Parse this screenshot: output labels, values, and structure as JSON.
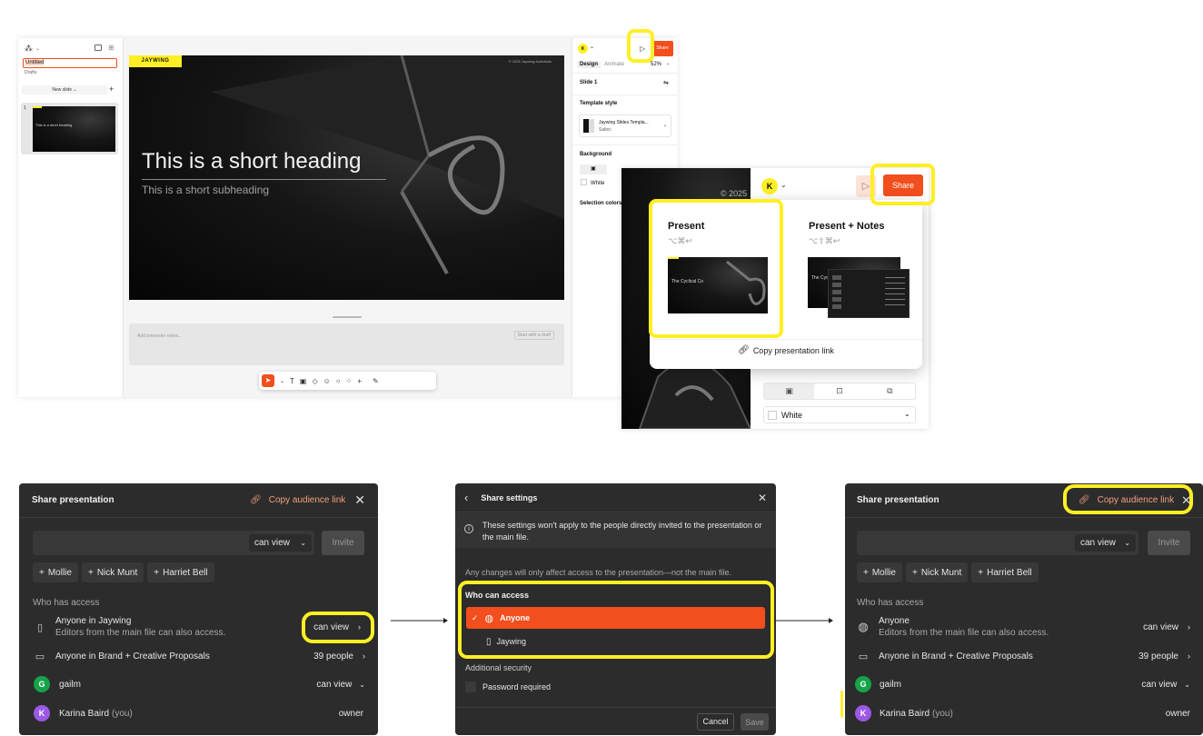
{
  "editor": {
    "file_title": "Untitled",
    "file_location": "Drafts",
    "new_slide": "New slide ⌄",
    "slide_number": "1",
    "thumb_heading": "This is a short heading",
    "brand_tag": "JAYWING",
    "copyright": "© 2025 Jaywing Audiobots",
    "heading": "This is a short heading",
    "subheading": "This is a short subheading",
    "notes_placeholder": "Add presenter notes...",
    "draft_button": "Start with a draft",
    "right": {
      "avatar": "K",
      "share": "Share",
      "tab_design": "Design",
      "tab_animate": "Animate",
      "zoom": "52%",
      "slide_label": "Slide 1",
      "template_style": "Template style",
      "template_name": "Jaywing Slides Templa...",
      "template_sub": "Saltec",
      "background": "Background",
      "bg_value": "White",
      "selection_colors": "Selection colors"
    }
  },
  "present": {
    "avatar": "K",
    "share": "Share",
    "copyright_partial": "© 2025 J",
    "option1_title": "Present",
    "option1_keys": "⌥⌘↩",
    "option1_thumb": "The Cyclical Co",
    "option2_title": "Present + Notes",
    "option2_keys": "⌥⇧⌘↩",
    "option2_thumb": "The Cyc",
    "copy_link": "Copy presentation link",
    "bg_value": "White"
  },
  "share1": {
    "title": "Share presentation",
    "copy_link": "Copy audience link",
    "permission": "can view",
    "invite": "Invite",
    "suggestions": [
      "Mollie",
      "Nick Munt",
      "Harriet Bell"
    ],
    "who_has_access": "Who has access",
    "rows": [
      {
        "name": "Anyone in Jaywing",
        "sub": "Editors from the main file can also access.",
        "right": "can view"
      },
      {
        "name": "Anyone in Brand + Creative Proposals",
        "right": "39 people"
      },
      {
        "name": "gailm",
        "right": "can view",
        "avatar": "G"
      },
      {
        "name": "Karina Baird",
        "you": "(you)",
        "right": "owner",
        "avatar": "K"
      }
    ]
  },
  "settings": {
    "title": "Share settings",
    "notice": "These settings won't apply to the people directly invited to the presentation or the main file.",
    "info": "Any changes will only affect access to the presentation—not the main file.",
    "who_can_access": "Who can access",
    "option_selected": "Anyone",
    "option_other": "Jaywing",
    "additional_security": "Additional security",
    "password": "Password required",
    "cancel": "Cancel",
    "save": "Save"
  },
  "share2": {
    "title": "Share presentation",
    "copy_link": "Copy audience link",
    "permission": "can view",
    "invite": "Invite",
    "suggestions": [
      "Mollie",
      "Nick Munt",
      "Harriet Bell"
    ],
    "who_has_access": "Who has access",
    "rows": [
      {
        "name": "Anyone",
        "sub": "Editors from the main file can also access.",
        "right": "can view"
      },
      {
        "name": "Anyone in Brand + Creative Proposals",
        "right": "39 people"
      },
      {
        "name": "gailm",
        "right": "can view",
        "avatar": "G"
      },
      {
        "name": "Karina Baird",
        "you": "(you)",
        "right": "owner",
        "avatar": "K"
      }
    ]
  },
  "colors": {
    "accent": "#F24E1E",
    "highlight": "#FFEF24",
    "dialog_bg": "#2C2C2C",
    "link_orange": "#F4A07A"
  }
}
